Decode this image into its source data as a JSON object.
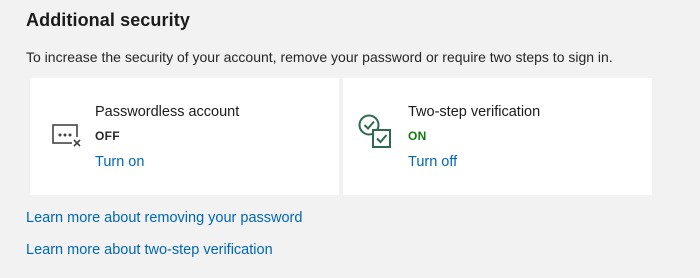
{
  "section": {
    "title": "Additional security",
    "description": "To increase the security of your account, remove your password or require two steps to sign in."
  },
  "cards": {
    "passwordless": {
      "icon": "password-dots-icon",
      "title": "Passwordless account",
      "status": "OFF",
      "action": "Turn on"
    },
    "two_step": {
      "icon": "two-step-check-icon",
      "title": "Two-step verification",
      "status": "ON",
      "status_color": "#107c10",
      "action": "Turn off"
    }
  },
  "links": {
    "learn_remove_password": "Learn more about removing your password",
    "learn_two_step": "Learn more about two-step verification"
  },
  "colors": {
    "link": "#0067b8",
    "on_status": "#107c10",
    "background": "#f2f2f2",
    "card": "#ffffff"
  }
}
